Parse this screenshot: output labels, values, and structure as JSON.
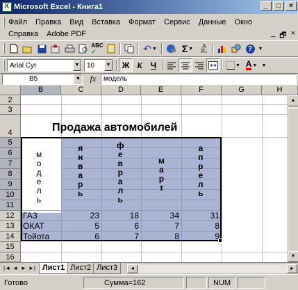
{
  "window": {
    "title": "Microsoft Excel - Книга1"
  },
  "menu": {
    "row1": [
      "Файл",
      "Правка",
      "Вид",
      "Вставка",
      "Формат",
      "Сервис",
      "Данные",
      "Окно"
    ],
    "row2": [
      "Справка",
      "Adobe PDF"
    ]
  },
  "toolbar": {
    "font_name": "Arial Cyr",
    "font_size": "10",
    "bold_label": "Ж",
    "italic_label": "К",
    "underline_label": "Ч",
    "sum_label": "Σ",
    "text_color": "#ff0000"
  },
  "formula_bar": {
    "name_box": "B5",
    "fx": "fx",
    "content": "модель"
  },
  "columns": [
    "B",
    "C",
    "D",
    "E",
    "F",
    "G",
    "H"
  ],
  "rows": [
    "2",
    "3",
    "4",
    "5",
    "6",
    "7",
    "8",
    "9",
    "10",
    "11",
    "12",
    "13",
    "14",
    "15",
    "16"
  ],
  "sheet": {
    "title": "Продажа автомобилей",
    "header_model": "модель",
    "months": [
      "январь",
      "февраль",
      "март",
      "апрель"
    ],
    "data_rows": [
      {
        "name": "ГАЗ",
        "values": [
          "23",
          "18",
          "34",
          "31"
        ]
      },
      {
        "name": "ОКАТ",
        "values": [
          "5",
          "6",
          "7",
          "8"
        ]
      },
      {
        "name": "Тойота",
        "values": [
          "6",
          "7",
          "8",
          "9"
        ]
      }
    ],
    "fill_color": "#aab5d4"
  },
  "tabs": [
    "Лист1",
    "Лист2",
    "Лист3"
  ],
  "status": {
    "ready": "Готово",
    "sum": "Сумма=162",
    "num": "NUM"
  }
}
